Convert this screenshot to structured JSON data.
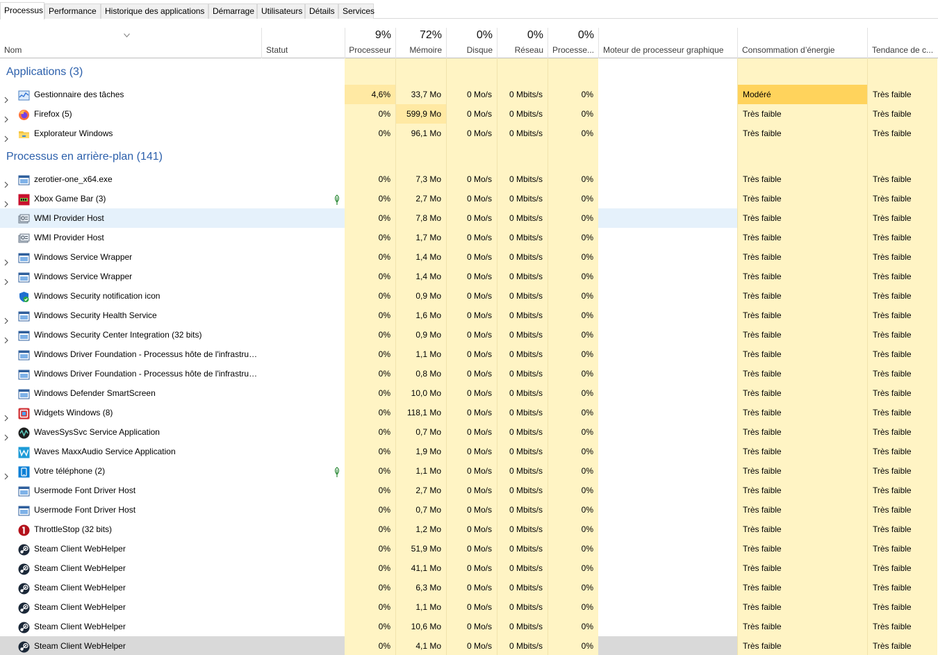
{
  "tabs": [
    "Processus",
    "Performance",
    "Historique des applications",
    "Démarrage",
    "Utilisateurs",
    "Détails",
    "Services"
  ],
  "columns": {
    "name": "Nom",
    "status": "Statut",
    "cpu": {
      "pct": "9%",
      "label": "Processeur"
    },
    "mem": {
      "pct": "72%",
      "label": "Mémoire"
    },
    "disk": {
      "pct": "0%",
      "label": "Disque"
    },
    "net": {
      "pct": "0%",
      "label": "Réseau"
    },
    "gpu": {
      "pct": "0%",
      "label": "Processe..."
    },
    "gpu_engine": "Moteur de processeur graphique",
    "power": "Consommation d’énergie",
    "trend": "Tendance de c..."
  },
  "groups": [
    {
      "title": "Applications (3)",
      "rows": [
        {
          "name": "Gestionnaire des tâches",
          "icon": "task-manager-icon",
          "expand": true,
          "leaf": false,
          "cpu": "4,6%",
          "mem": "33,7 Mo",
          "disk": "0 Mo/s",
          "net": "0 Mbits/s",
          "gpu": "0%",
          "power": "Modéré",
          "trend": "Très faible",
          "cpuLevel": 2,
          "memLevel": 1,
          "powerLevel": 3
        },
        {
          "name": "Firefox (5)",
          "icon": "firefox-icon",
          "expand": true,
          "leaf": false,
          "cpu": "0%",
          "mem": "599,9 Mo",
          "disk": "0 Mo/s",
          "net": "0 Mbits/s",
          "gpu": "0%",
          "power": "Très faible",
          "trend": "Très faible",
          "cpuLevel": 1,
          "memLevel": 2,
          "powerLevel": 1
        },
        {
          "name": "Explorateur Windows",
          "icon": "explorer-folder-icon",
          "expand": true,
          "leaf": false,
          "cpu": "0%",
          "mem": "96,1 Mo",
          "disk": "0 Mo/s",
          "net": "0 Mbits/s",
          "gpu": "0%",
          "power": "Très faible",
          "trend": "Très faible",
          "cpuLevel": 1,
          "memLevel": 1,
          "powerLevel": 1
        }
      ]
    },
    {
      "title": "Processus en arrière-plan (141)",
      "rows": [
        {
          "name": "zerotier-one_x64.exe",
          "icon": "service-window-icon",
          "expand": true,
          "leaf": false,
          "cpu": "0%",
          "mem": "7,3 Mo",
          "disk": "0 Mo/s",
          "net": "0 Mbits/s",
          "gpu": "0%",
          "power": "Très faible",
          "trend": "Très faible",
          "cpuLevel": 1,
          "memLevel": 1,
          "powerLevel": 1
        },
        {
          "name": "Xbox Game Bar (3)",
          "icon": "xbox-game-bar-icon",
          "expand": true,
          "leaf": true,
          "cpu": "0%",
          "mem": "2,7 Mo",
          "disk": "0 Mo/s",
          "net": "0 Mbits/s",
          "gpu": "0%",
          "power": "Très faible",
          "trend": "Très faible",
          "cpuLevel": 1,
          "memLevel": 1,
          "powerLevel": 1
        },
        {
          "name": "WMI Provider Host",
          "icon": "wmi-icon",
          "expand": false,
          "leaf": false,
          "cpu": "0%",
          "mem": "7,8 Mo",
          "disk": "0 Mo/s",
          "net": "0 Mbits/s",
          "gpu": "0%",
          "power": "Très faible",
          "trend": "Très faible",
          "cpuLevel": 1,
          "memLevel": 1,
          "powerLevel": 1,
          "state": "hover"
        },
        {
          "name": "WMI Provider Host",
          "icon": "wmi-icon",
          "expand": false,
          "leaf": false,
          "cpu": "0%",
          "mem": "1,7 Mo",
          "disk": "0 Mo/s",
          "net": "0 Mbits/s",
          "gpu": "0%",
          "power": "Très faible",
          "trend": "Très faible",
          "cpuLevel": 1,
          "memLevel": 1,
          "powerLevel": 1
        },
        {
          "name": "Windows Service Wrapper",
          "icon": "service-window-icon",
          "expand": true,
          "leaf": false,
          "cpu": "0%",
          "mem": "1,4 Mo",
          "disk": "0 Mo/s",
          "net": "0 Mbits/s",
          "gpu": "0%",
          "power": "Très faible",
          "trend": "Très faible",
          "cpuLevel": 1,
          "memLevel": 1,
          "powerLevel": 1
        },
        {
          "name": "Windows Service Wrapper",
          "icon": "service-window-icon",
          "expand": true,
          "leaf": false,
          "cpu": "0%",
          "mem": "1,4 Mo",
          "disk": "0 Mo/s",
          "net": "0 Mbits/s",
          "gpu": "0%",
          "power": "Très faible",
          "trend": "Très faible",
          "cpuLevel": 1,
          "memLevel": 1,
          "powerLevel": 1
        },
        {
          "name": "Windows Security notification icon",
          "icon": "security-shield-icon",
          "expand": false,
          "leaf": false,
          "cpu": "0%",
          "mem": "0,9 Mo",
          "disk": "0 Mo/s",
          "net": "0 Mbits/s",
          "gpu": "0%",
          "power": "Très faible",
          "trend": "Très faible",
          "cpuLevel": 1,
          "memLevel": 1,
          "powerLevel": 1
        },
        {
          "name": "Windows Security Health Service",
          "icon": "service-window-icon",
          "expand": true,
          "leaf": false,
          "cpu": "0%",
          "mem": "1,6 Mo",
          "disk": "0 Mo/s",
          "net": "0 Mbits/s",
          "gpu": "0%",
          "power": "Très faible",
          "trend": "Très faible",
          "cpuLevel": 1,
          "memLevel": 1,
          "powerLevel": 1
        },
        {
          "name": "Windows Security Center Integration (32 bits)",
          "icon": "service-window-icon",
          "expand": true,
          "leaf": false,
          "cpu": "0%",
          "mem": "0,9 Mo",
          "disk": "0 Mo/s",
          "net": "0 Mbits/s",
          "gpu": "0%",
          "power": "Très faible",
          "trend": "Très faible",
          "cpuLevel": 1,
          "memLevel": 1,
          "powerLevel": 1
        },
        {
          "name": "Windows Driver Foundation - Processus hôte de l'infrastruc...",
          "icon": "service-window-icon",
          "expand": false,
          "leaf": false,
          "cpu": "0%",
          "mem": "1,1 Mo",
          "disk": "0 Mo/s",
          "net": "0 Mbits/s",
          "gpu": "0%",
          "power": "Très faible",
          "trend": "Très faible",
          "cpuLevel": 1,
          "memLevel": 1,
          "powerLevel": 1
        },
        {
          "name": "Windows Driver Foundation - Processus hôte de l'infrastruc...",
          "icon": "service-window-icon",
          "expand": false,
          "leaf": false,
          "cpu": "0%",
          "mem": "0,8 Mo",
          "disk": "0 Mo/s",
          "net": "0 Mbits/s",
          "gpu": "0%",
          "power": "Très faible",
          "trend": "Très faible",
          "cpuLevel": 1,
          "memLevel": 1,
          "powerLevel": 1
        },
        {
          "name": "Windows Defender SmartScreen",
          "icon": "service-window-icon",
          "expand": false,
          "leaf": false,
          "cpu": "0%",
          "mem": "10,0 Mo",
          "disk": "0 Mo/s",
          "net": "0 Mbits/s",
          "gpu": "0%",
          "power": "Très faible",
          "trend": "Très faible",
          "cpuLevel": 1,
          "memLevel": 1,
          "powerLevel": 1
        },
        {
          "name": "Widgets Windows (8)",
          "icon": "widgets-icon",
          "expand": true,
          "leaf": false,
          "cpu": "0%",
          "mem": "118,1 Mo",
          "disk": "0 Mo/s",
          "net": "0 Mbits/s",
          "gpu": "0%",
          "power": "Très faible",
          "trend": "Très faible",
          "cpuLevel": 1,
          "memLevel": 1,
          "powerLevel": 1
        },
        {
          "name": "WavesSysSvc Service Application",
          "icon": "waves-circle-icon",
          "expand": true,
          "leaf": false,
          "cpu": "0%",
          "mem": "0,7 Mo",
          "disk": "0 Mo/s",
          "net": "0 Mbits/s",
          "gpu": "0%",
          "power": "Très faible",
          "trend": "Très faible",
          "cpuLevel": 1,
          "memLevel": 1,
          "powerLevel": 1
        },
        {
          "name": "Waves MaxxAudio Service Application",
          "icon": "waves-maxx-icon",
          "expand": false,
          "leaf": false,
          "cpu": "0%",
          "mem": "1,9 Mo",
          "disk": "0 Mo/s",
          "net": "0 Mbits/s",
          "gpu": "0%",
          "power": "Très faible",
          "trend": "Très faible",
          "cpuLevel": 1,
          "memLevel": 1,
          "powerLevel": 1
        },
        {
          "name": "Votre téléphone (2)",
          "icon": "phone-link-icon",
          "expand": true,
          "leaf": true,
          "cpu": "0%",
          "mem": "1,1 Mo",
          "disk": "0 Mo/s",
          "net": "0 Mbits/s",
          "gpu": "0%",
          "power": "Très faible",
          "trend": "Très faible",
          "cpuLevel": 1,
          "memLevel": 1,
          "powerLevel": 1
        },
        {
          "name": "Usermode Font Driver Host",
          "icon": "service-window-icon",
          "expand": false,
          "leaf": false,
          "cpu": "0%",
          "mem": "2,7 Mo",
          "disk": "0 Mo/s",
          "net": "0 Mbits/s",
          "gpu": "0%",
          "power": "Très faible",
          "trend": "Très faible",
          "cpuLevel": 1,
          "memLevel": 1,
          "powerLevel": 1
        },
        {
          "name": "Usermode Font Driver Host",
          "icon": "service-window-icon",
          "expand": false,
          "leaf": false,
          "cpu": "0%",
          "mem": "0,7 Mo",
          "disk": "0 Mo/s",
          "net": "0 Mbits/s",
          "gpu": "0%",
          "power": "Très faible",
          "trend": "Très faible",
          "cpuLevel": 1,
          "memLevel": 1,
          "powerLevel": 1
        },
        {
          "name": "ThrottleStop (32 bits)",
          "icon": "throttlestop-icon",
          "expand": false,
          "leaf": false,
          "cpu": "0%",
          "mem": "1,2 Mo",
          "disk": "0 Mo/s",
          "net": "0 Mbits/s",
          "gpu": "0%",
          "power": "Très faible",
          "trend": "Très faible",
          "cpuLevel": 1,
          "memLevel": 1,
          "powerLevel": 1
        },
        {
          "name": "Steam Client WebHelper",
          "icon": "steam-icon",
          "expand": false,
          "leaf": false,
          "cpu": "0%",
          "mem": "51,9 Mo",
          "disk": "0 Mo/s",
          "net": "0 Mbits/s",
          "gpu": "0%",
          "power": "Très faible",
          "trend": "Très faible",
          "cpuLevel": 1,
          "memLevel": 1,
          "powerLevel": 1
        },
        {
          "name": "Steam Client WebHelper",
          "icon": "steam-icon",
          "expand": false,
          "leaf": false,
          "cpu": "0%",
          "mem": "41,1 Mo",
          "disk": "0 Mo/s",
          "net": "0 Mbits/s",
          "gpu": "0%",
          "power": "Très faible",
          "trend": "Très faible",
          "cpuLevel": 1,
          "memLevel": 1,
          "powerLevel": 1
        },
        {
          "name": "Steam Client WebHelper",
          "icon": "steam-icon",
          "expand": false,
          "leaf": false,
          "cpu": "0%",
          "mem": "6,3 Mo",
          "disk": "0 Mo/s",
          "net": "0 Mbits/s",
          "gpu": "0%",
          "power": "Très faible",
          "trend": "Très faible",
          "cpuLevel": 1,
          "memLevel": 1,
          "powerLevel": 1
        },
        {
          "name": "Steam Client WebHelper",
          "icon": "steam-icon",
          "expand": false,
          "leaf": false,
          "cpu": "0%",
          "mem": "1,1 Mo",
          "disk": "0 Mo/s",
          "net": "0 Mbits/s",
          "gpu": "0%",
          "power": "Très faible",
          "trend": "Très faible",
          "cpuLevel": 1,
          "memLevel": 1,
          "powerLevel": 1
        },
        {
          "name": "Steam Client WebHelper",
          "icon": "steam-icon",
          "expand": false,
          "leaf": false,
          "cpu": "0%",
          "mem": "10,6 Mo",
          "disk": "0 Mo/s",
          "net": "0 Mbits/s",
          "gpu": "0%",
          "power": "Très faible",
          "trend": "Très faible",
          "cpuLevel": 1,
          "memLevel": 1,
          "powerLevel": 1
        },
        {
          "name": "Steam Client WebHelper",
          "icon": "steam-icon",
          "expand": false,
          "leaf": false,
          "cpu": "0%",
          "mem": "4,1 Mo",
          "disk": "0 Mo/s",
          "net": "0 Mbits/s",
          "gpu": "0%",
          "power": "Très faible",
          "trend": "Très faible",
          "cpuLevel": 1,
          "memLevel": 1,
          "powerLevel": 1,
          "state": "selected"
        }
      ]
    }
  ],
  "colors": {
    "heat_low": "#fff4c4",
    "heat_mid": "#ffe9a3",
    "heat_high": "#ffd35c",
    "group_title": "#2b5fab",
    "hover": "#e5f1fb",
    "selected": "#d9d9d9"
  }
}
